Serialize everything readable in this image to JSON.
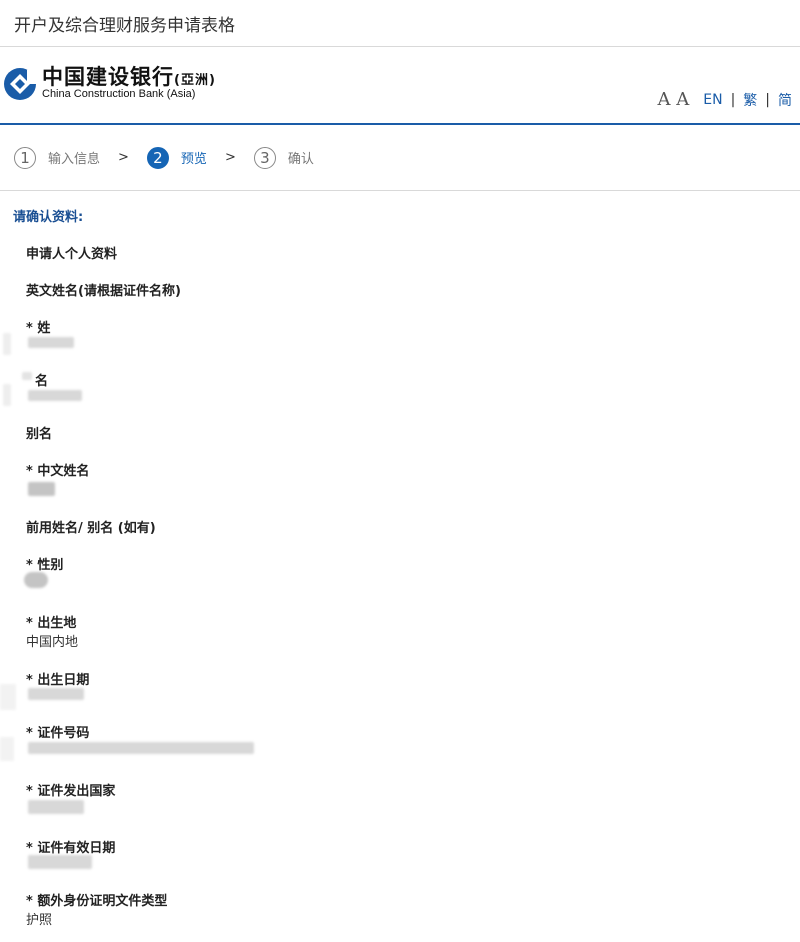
{
  "window": {
    "title": "开户及综合理财服务申请表格"
  },
  "bank": {
    "name_cn": "中国建设银行",
    "name_cn_suffix": "(亞洲)",
    "name_en": "China Construction Bank (Asia)"
  },
  "language": {
    "font_size_icon": "A A",
    "options": [
      "EN",
      "繁",
      "简"
    ]
  },
  "steps": [
    {
      "number": "1",
      "label": "输入信息"
    },
    {
      "number": "2",
      "label": "预览"
    },
    {
      "number": "3",
      "label": "确认"
    }
  ],
  "step_arrow": ">",
  "confirm_title": "请确认资料:",
  "sections": {
    "personal": "申请人个人资料",
    "english_name": "英文姓名(请根据证件名称)"
  },
  "fields": {
    "surname": "* 姓",
    "given_name": "名",
    "alias": "别名",
    "chinese_name": "* 中文姓名",
    "former_name": "前用姓名/ 别名 (如有)",
    "gender": "* 性别",
    "birthplace": "* 出生地",
    "birthplace_value": "中国内地",
    "birth_date": "* 出生日期",
    "id_number": "* 证件号码",
    "id_country": "* 证件发出国家",
    "id_expiry": "* 证件有效日期",
    "extra_id_type": "* 额外身份证明文件类型",
    "extra_id_type_value": "护照"
  },
  "colors": {
    "brand": "#1a5ca8",
    "active_step": "#1565b5",
    "title": "#1a4f93"
  }
}
